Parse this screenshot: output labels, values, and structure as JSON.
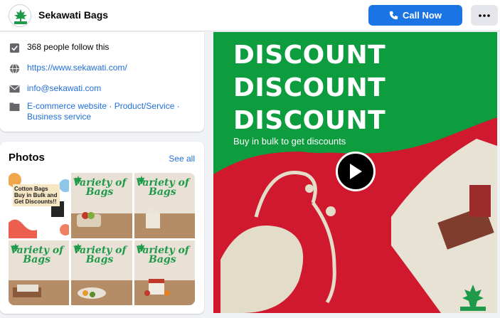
{
  "header": {
    "page_name": "Sekawati Bags",
    "call_button_label": "Call Now",
    "more_icon": "more-horizontal-icon",
    "call_icon": "phone-icon"
  },
  "intro": {
    "followers_text": "368 people follow this",
    "website": "https://www.sekawati.com/",
    "email": "info@sekawati.com",
    "categories_line1": "E-commerce website · Product/Service ·",
    "categories_line2": "Business service"
  },
  "photos": {
    "title": "Photos",
    "see_all_label": "See all",
    "tiles": [
      {
        "caption": "Cotton Bags Buy in Bulk and Get Discounts!!"
      },
      {
        "caption": "Variety of Bags"
      },
      {
        "caption": "Variety of Bags"
      },
      {
        "caption": "Variety of Bags"
      },
      {
        "caption": "Variety of Bags"
      },
      {
        "caption": "Variety of Bags"
      }
    ]
  },
  "media": {
    "line1": "DISCOUNT",
    "line2": "DISCOUNT",
    "line3": "DISCOUNT",
    "tagline": "Buy in bulk to get discounts",
    "play_icon": "play-icon"
  },
  "colors": {
    "primary_blue": "#1b74e4",
    "link_blue": "#216fdb",
    "brand_green": "#0e9d3e",
    "brand_red": "#d0182e"
  }
}
